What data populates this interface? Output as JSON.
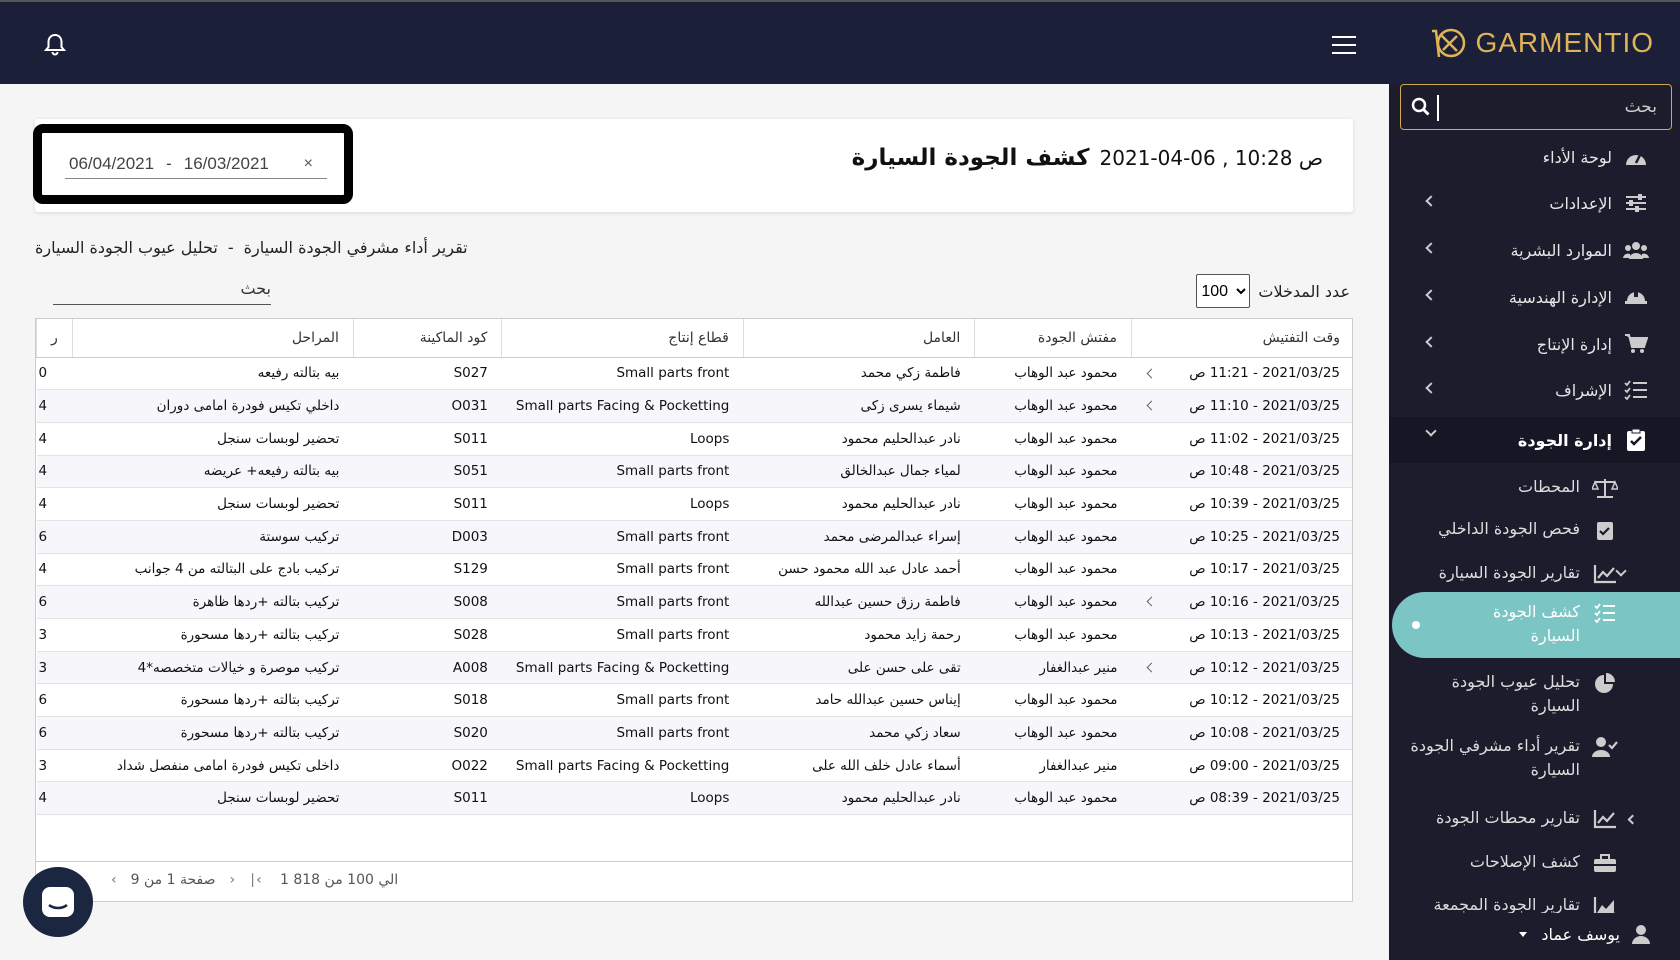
{
  "app": {
    "logo": "GARMENTIO"
  },
  "sidebar": {
    "search_placeholder": "بحث",
    "items": [
      {
        "label": "لوحة الأداء",
        "icon": "dashboard-icon"
      },
      {
        "label": "الإعدادات",
        "icon": "sliders-icon"
      },
      {
        "label": "الموارد البشرية",
        "icon": "users-icon"
      },
      {
        "label": "الإدارة الهندسية",
        "icon": "hardhat-icon"
      },
      {
        "label": "إدارة الإنتاج",
        "icon": "cart-icon"
      },
      {
        "label": "الإشراف",
        "icon": "checklist-icon"
      },
      {
        "label": "إدارة الجودة",
        "icon": "clipboard-check-icon"
      }
    ],
    "sub_items": [
      {
        "label": "المحطات",
        "icon": "scale-icon"
      },
      {
        "label": "فحص الجودة الداخلي",
        "icon": "clipboard-check-icon"
      },
      {
        "label": "تقارير الجودة السيارة",
        "icon": "line-chart-icon"
      },
      {
        "label": "كشف الجودة السيارة",
        "icon": "list-icon"
      },
      {
        "label": "تحليل عيوب الجودة السيارة",
        "icon": "pie-chart-icon"
      },
      {
        "label": "تقرير أداء مشرفي الجودة السيارة",
        "icon": "user-check-icon"
      },
      {
        "label": "تقارير محطات الجودة",
        "icon": "line-chart-icon"
      },
      {
        "label": "كشف الإصلاحات",
        "icon": "toolbox-icon"
      },
      {
        "label": "تقارير الجودة المجمعة",
        "icon": "area-chart-icon"
      }
    ],
    "user": "يوسف عماد"
  },
  "header": {
    "title": "كشف الجودة السيارة",
    "datetime": "2021-04-06 , 10:28 ص",
    "date_from": "16/03/2021",
    "date_to": "06/04/2021",
    "date_sep": "-",
    "clear": "×"
  },
  "links": {
    "link1": "تقرير أداء مشرفي الجودة السيارة",
    "sep": "-",
    "link2": "تحليل عيوب الجودة السيارة"
  },
  "table_controls": {
    "entries_label": "عدد المدخلات",
    "entries_value": "100",
    "search_placeholder": "بحث"
  },
  "table": {
    "columns": [
      "وقت التفتيش",
      "مفتش الجودة",
      "العامل",
      "قطاع إنتاج",
      "كود الماكينة",
      "المراحل",
      "ر"
    ],
    "rows": [
      {
        "time": "2021/03/25 - 11:21 ص",
        "inspector": "محمود عبد الوهاب",
        "worker": "فاطمة زكي محمد",
        "sector": "Small parts front",
        "code": "S027",
        "stage": "بيه بتالته رفيعه",
        "extra": "0",
        "expand": true
      },
      {
        "time": "2021/03/25 - 11:10 ص",
        "inspector": "محمود عبد الوهاب",
        "worker": "شيماء يسرى زكى",
        "sector": "Small parts Facing & Pocketting",
        "code": "O031",
        "stage": "داخلي تكيس فودرة امامى دوران",
        "extra": "4",
        "expand": true
      },
      {
        "time": "2021/03/25 - 11:02 ص",
        "inspector": "محمود عبد الوهاب",
        "worker": "نادر عبدالحليم محمود",
        "sector": "Loops",
        "code": "S011",
        "stage": "تحضير لوبسات سنجل",
        "extra": "4",
        "expand": false
      },
      {
        "time": "2021/03/25 - 10:48 ص",
        "inspector": "محمود عبد الوهاب",
        "worker": "لمياء جمال عبدالخالق",
        "sector": "Small parts front",
        "code": "S051",
        "stage": "بيه بتالته رفيعه+ عريضه",
        "extra": "4",
        "expand": false
      },
      {
        "time": "2021/03/25 - 10:39 ص",
        "inspector": "محمود عبد الوهاب",
        "worker": "نادر عبدالحليم محمود",
        "sector": "Loops",
        "code": "S011",
        "stage": "تحضير لوبسات سنجل",
        "extra": "4",
        "expand": false
      },
      {
        "time": "2021/03/25 - 10:25 ص",
        "inspector": "محمود عبد الوهاب",
        "worker": "إسراء عبدالمرضى محمد",
        "sector": "Small parts front",
        "code": "D003",
        "stage": "تركيب سوستة",
        "extra": "6",
        "expand": false
      },
      {
        "time": "2021/03/25 - 10:17 ص",
        "inspector": "محمود عبد الوهاب",
        "worker": "أحمد عادل عبد الله محمود حسن",
        "sector": "Small parts front",
        "code": "S129",
        "stage": "تركيب بادج على البتالته من 4 جوانب",
        "extra": "4",
        "expand": false
      },
      {
        "time": "2021/03/25 - 10:16 ص",
        "inspector": "محمود عبد الوهاب",
        "worker": "فاطمة رزق حسين عبدالله",
        "sector": "Small parts front",
        "code": "S008",
        "stage": "تركيب بتالته +ردها ظاهرة",
        "extra": "6",
        "expand": true
      },
      {
        "time": "2021/03/25 - 10:13 ص",
        "inspector": "محمود عبد الوهاب",
        "worker": "رحمة زايد محمود",
        "sector": "Small parts front",
        "code": "S028",
        "stage": "تركيب بتالته +ردها مسحورة",
        "extra": "3",
        "expand": false
      },
      {
        "time": "2021/03/25 - 10:12 ص",
        "inspector": "منير عبدالغفار",
        "worker": "تقى على حسن على",
        "sector": "Small parts Facing & Pocketting",
        "code": "A008",
        "stage": "تركيب موصرة و خيالات متخصصه*4",
        "extra": "3",
        "expand": true
      },
      {
        "time": "2021/03/25 - 10:12 ص",
        "inspector": "محمود عبد الوهاب",
        "worker": "إيناس حسين عبدالله حامد",
        "sector": "Small parts front",
        "code": "S018",
        "stage": "تركيب بتالته +ردها مسحورة",
        "extra": "6",
        "expand": false
      },
      {
        "time": "2021/03/25 - 10:08 ص",
        "inspector": "محمود عبد الوهاب",
        "worker": "سعاد زكي محمد",
        "sector": "Small parts front",
        "code": "S020",
        "stage": "تركيب بتالته +ردها مسحورة",
        "extra": "6",
        "expand": false
      },
      {
        "time": "2021/03/25 - 09:00 ص",
        "inspector": "منير عبدالغفار",
        "worker": "أسماء عادل خلف الله على",
        "sector": "Small parts Facing & Pocketting",
        "code": "O022",
        "stage": "داخلى تكيس فودرة امامى منفصل شداد",
        "extra": "3",
        "expand": false
      },
      {
        "time": "2021/03/25 - 08:39 ص",
        "inspector": "محمود عبد الوهاب",
        "worker": "نادر عبدالحليم محمود",
        "sector": "Loops",
        "code": "S011",
        "stage": "تحضير لوبسات سنجل",
        "extra": "4",
        "expand": false
      }
    ]
  },
  "pagination": {
    "range": "1 الي 100 من 818",
    "page_info": "صفحة 1 من 9"
  },
  "colors": {
    "topbar": "#1b1f38",
    "sidebar": "#1c1c2c",
    "accent": "#e0b454",
    "selected": "#7bc5c4"
  }
}
